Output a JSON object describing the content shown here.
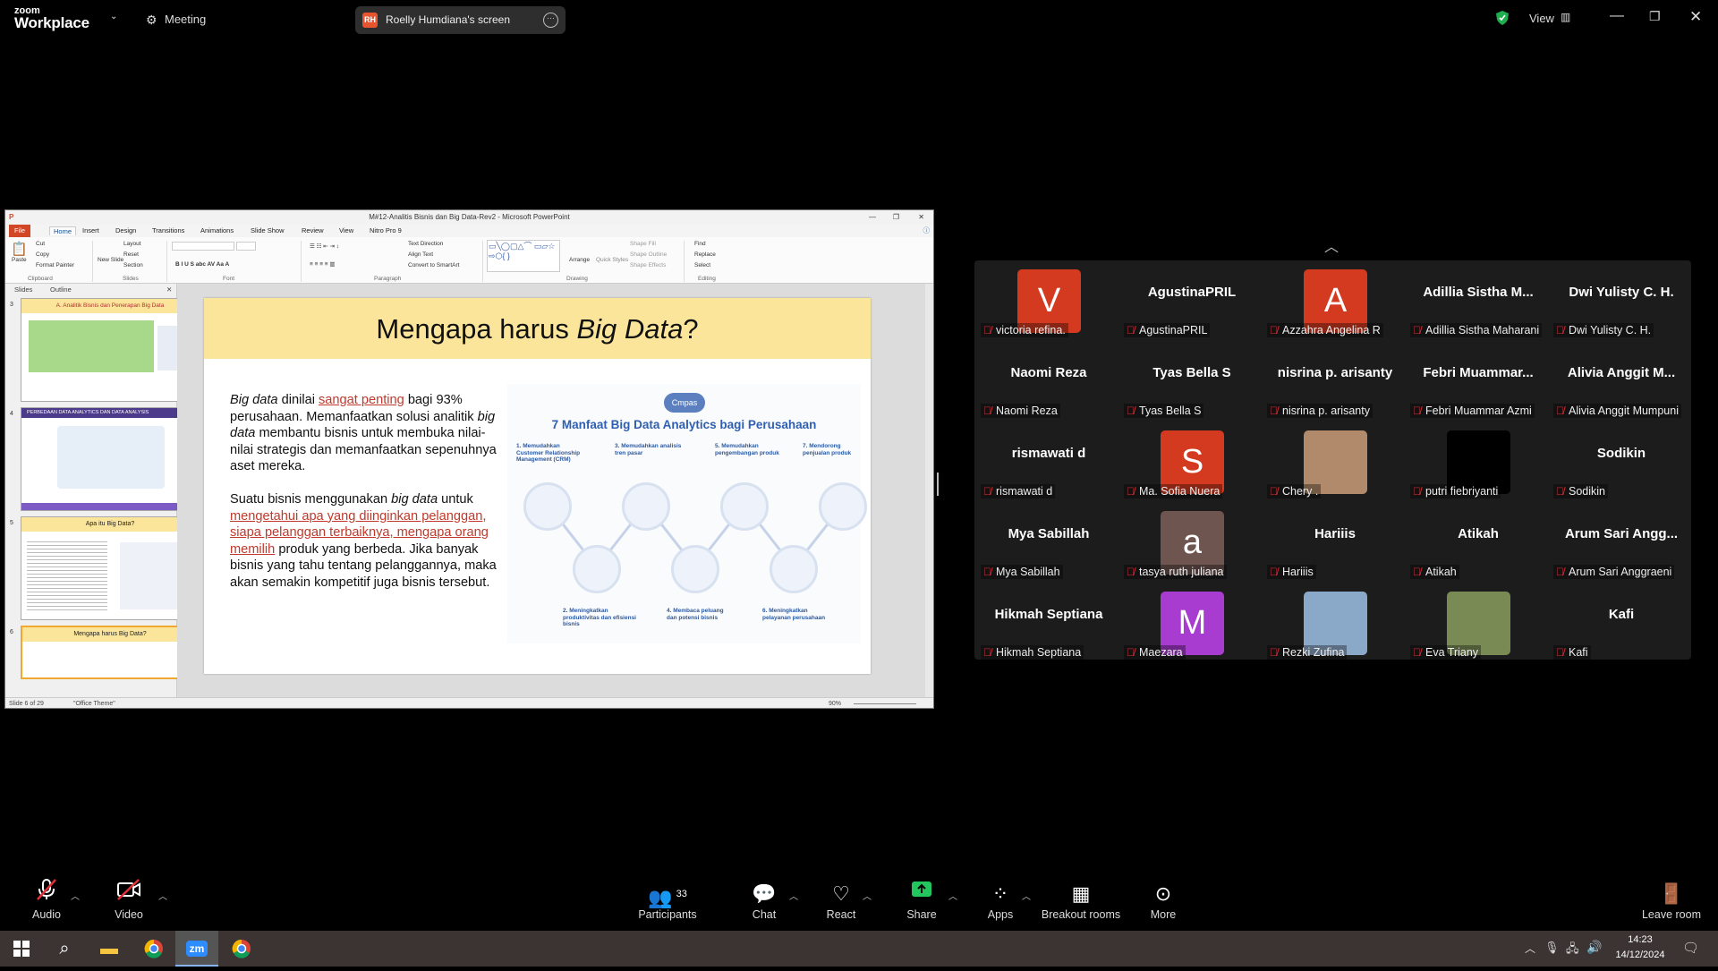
{
  "zoom": {
    "logo_line1": "zoom",
    "logo_line2": "Workplace",
    "meeting_label": "Meeting",
    "share_badge": "RH",
    "share_label": "Roelly Humdiana's screen",
    "view_label": "View"
  },
  "ppt": {
    "window_title": "M#12-Analitis Bisnis dan Big Data-Rev2 - Microsoft PowerPoint",
    "menu": [
      "File",
      "Home",
      "Insert",
      "Design",
      "Transitions",
      "Animations",
      "Slide Show",
      "Review",
      "View",
      "Nitro Pro 9"
    ],
    "ribbon_groups": [
      "Clipboard",
      "Slides",
      "Font",
      "Paragraph",
      "Drawing",
      "Editing"
    ],
    "ribbon_items": {
      "paste": "Paste",
      "cut": "Cut",
      "copy": "Copy",
      "format_painter": "Format Painter",
      "new_slide": "New Slide",
      "layout": "Layout",
      "reset": "Reset",
      "section": "Section",
      "text_direction": "Text Direction",
      "align_text": "Align Text",
      "convert": "Convert to SmartArt",
      "arrange": "Arrange",
      "quick_styles": "Quick Styles",
      "shape_fill": "Shape Fill",
      "shape_outline": "Shape Outline",
      "shape_effects": "Shape Effects",
      "find": "Find",
      "replace": "Replace",
      "select": "Select"
    },
    "pane_tabs": [
      "Slides",
      "Outline"
    ],
    "thumbs": [
      {
        "num": "3",
        "title": "A. Analitik Bisnis dan Penerapan Big Data"
      },
      {
        "num": "4",
        "title": "PERBEDAAN DATA ANALYTICS DAN DATA ANALYSIS"
      },
      {
        "num": "5",
        "title": "Apa itu Big Data?"
      },
      {
        "num": "6",
        "title": "Mengapa harus Big Data?"
      }
    ],
    "slide": {
      "title_a": "Mengapa harus ",
      "title_b": "Big Data",
      "title_c": "?",
      "p1": [
        {
          "t": "Big data",
          "s": "i"
        },
        {
          "t": " dinilai  ",
          "s": ""
        },
        {
          "t": "sangat penting",
          "s": "r"
        },
        {
          "t": " bagi 93% perusahaan. Memanfaatkan solusi analitik ",
          "s": ""
        },
        {
          "t": "big data",
          "s": "i"
        },
        {
          "t": " membantu bisnis untuk membuka nilai-nilai strategis dan memanfaatkan sepenuhnya aset mereka.",
          "s": ""
        }
      ],
      "p2": [
        {
          "t": "Suatu bisnis menggunakan ",
          "s": ""
        },
        {
          "t": "big data",
          "s": "i"
        },
        {
          "t": " untuk ",
          "s": ""
        },
        {
          "t": "mengetahui apa yang diinginkan pelanggan, siapa pelanggan terbaiknya, mengapa orang memilih",
          "s": "r"
        },
        {
          "t": " produk yang berbeda. Jika banyak bisnis yang tahu tentang pelanggannya, maka akan semakin kompetitif juga bisnis tersebut.",
          "s": ""
        }
      ],
      "info_title": "7 Manfaat Big Data Analytics bagi Perusahaan",
      "info_badge": "Cmpas",
      "info_items": [
        "1. Memudahkan Customer Relationship Management (CRM)",
        "2. Meningkatkan produktivitas dan efisiensi bisnis",
        "3. Memudahkan analisis tren pasar",
        "4. Membaca peluang dan potensi bisnis",
        "5. Memudahkan pengembangan produk",
        "6. Meningkatkan pelayanan perusahaan",
        "7. Mendorong penjualan produk"
      ]
    },
    "status": {
      "slide": "Slide 6 of 29",
      "theme": "\"Office Theme\"",
      "zoom": "90%"
    }
  },
  "participants": [
    {
      "big": "V",
      "label": "victoria refina.",
      "kind": "avatar",
      "color": "#d33a1f"
    },
    {
      "big": "AgustinaPRIL",
      "label": "AgustinaPRIL",
      "kind": "name"
    },
    {
      "big": "A",
      "label": "Azzahra Angelina R",
      "kind": "avatar",
      "color": "#d33a1f"
    },
    {
      "big": "Adillia Sistha M...",
      "label": "Adillia Sistha Maharani",
      "kind": "name"
    },
    {
      "big": "Dwi Yulisty C. H.",
      "label": "Dwi Yulisty C. H.",
      "kind": "name"
    },
    {
      "big": "Naomi Reza",
      "label": "Naomi Reza",
      "kind": "name"
    },
    {
      "big": "Tyas Bella S",
      "label": "Tyas Bella S",
      "kind": "name"
    },
    {
      "big": "nisrina p. arisanty",
      "label": "nisrina p. arisanty",
      "kind": "name"
    },
    {
      "big": "Febri  Muammar...",
      "label": "Febri Muammar Azmi",
      "kind": "name"
    },
    {
      "big": "Alivia Anggit M...",
      "label": "Alivia Anggit Mumpuni",
      "kind": "name"
    },
    {
      "big": "rismawati d",
      "label": "rismawati d",
      "kind": "name"
    },
    {
      "big": "S",
      "label": "Ma. Sofia Nuera",
      "kind": "avatar",
      "color": "#d33a1f"
    },
    {
      "big": "",
      "label": "Chery .",
      "kind": "photo",
      "color": "#b08a6a"
    },
    {
      "big": "",
      "label": "putri fiebriyanti",
      "kind": "photo",
      "color": "#000000"
    },
    {
      "big": "Sodikin",
      "label": "Sodikin",
      "kind": "name"
    },
    {
      "big": "Mya Sabillah",
      "label": "Mya Sabillah",
      "kind": "name"
    },
    {
      "big": "a",
      "label": "tasya ruth juliana",
      "kind": "avatar",
      "color": "#6e5550"
    },
    {
      "big": "Hariiis",
      "label": "Hariiis",
      "kind": "name"
    },
    {
      "big": "Atikah",
      "label": "Atikah",
      "kind": "name"
    },
    {
      "big": "Arum Sari Angg...",
      "label": "Arum Sari Anggraeni",
      "kind": "name"
    },
    {
      "big": "Hikmah Septiana",
      "label": "Hikmah Septiana",
      "kind": "name"
    },
    {
      "big": "M",
      "label": "Maezara",
      "kind": "avatar",
      "color": "#a83bd0"
    },
    {
      "big": "",
      "label": "Rezki Zufina",
      "kind": "photo",
      "color": "#8aa8c8"
    },
    {
      "big": "",
      "label": "Eva Triany",
      "kind": "photo",
      "color": "#7a8a55"
    },
    {
      "big": "Kafi",
      "label": "Kafi",
      "kind": "name"
    }
  ],
  "toolbar": {
    "audio": "Audio",
    "video": "Video",
    "participants": "Participants",
    "participants_count": "33",
    "chat": "Chat",
    "react": "React",
    "share": "Share",
    "apps": "Apps",
    "breakout": "Breakout rooms",
    "more": "More",
    "leave": "Leave room"
  },
  "taskbar": {
    "time": "14:23",
    "date": "14/12/2024"
  },
  "colors": {
    "share_green": "#22c55e",
    "mute_red": "#e0313b",
    "ppt_file": "#d24726",
    "slide_header": "#fbe59a"
  }
}
